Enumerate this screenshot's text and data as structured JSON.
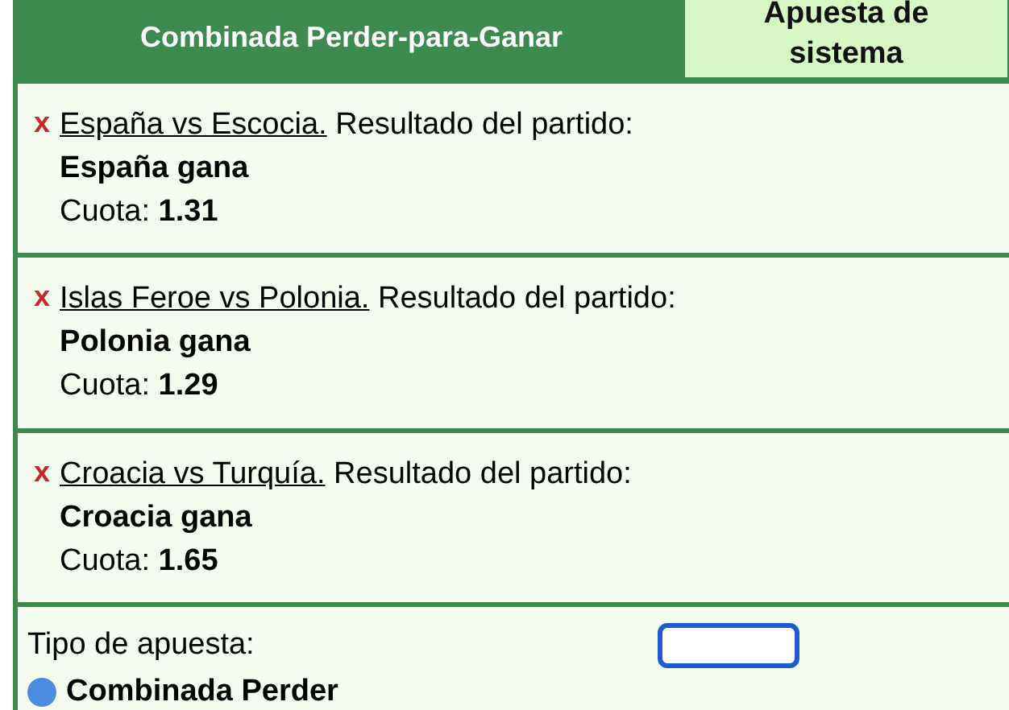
{
  "tabs": [
    {
      "label": "Combinada Perder-para-Ganar",
      "selected": true
    },
    {
      "label": "Apuesta de sistema",
      "selected": false
    }
  ],
  "selections": [
    {
      "icon": "x",
      "match": "España vs Escocia.",
      "market": "Resultado del partido:",
      "pick": "España gana",
      "odds_label": "Cuota:",
      "odds": "1.31"
    },
    {
      "icon": "x",
      "match": "Islas Feroe vs Polonia.",
      "market": "Resultado del partido:",
      "pick": "Polonia gana",
      "odds_label": "Cuota:",
      "odds": "1.29"
    },
    {
      "icon": "x",
      "match": "Croacia vs Turquía.",
      "market": "Resultado del partido:",
      "pick": "Croacia gana",
      "odds_label": "Cuota:",
      "odds": "1.65"
    }
  ],
  "bet_type": {
    "label": "Tipo de apuesta:",
    "option": "Combinada Perder",
    "selected": true
  }
}
